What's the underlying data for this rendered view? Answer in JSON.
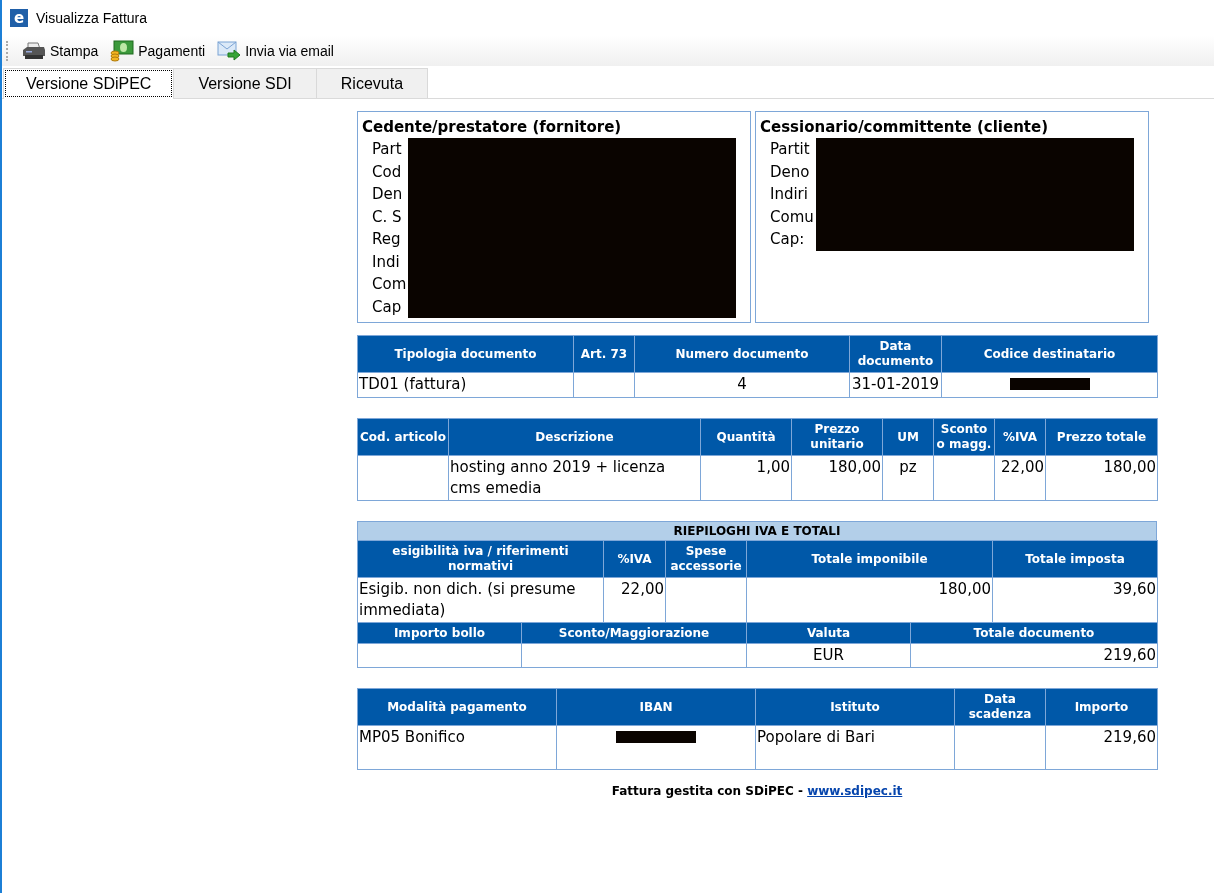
{
  "window": {
    "title": "Visualizza Fattura",
    "icon_letter": "e"
  },
  "toolbar": [
    {
      "label": "Stampa",
      "kind": "printer"
    },
    {
      "label": "Pagamenti",
      "kind": "money"
    },
    {
      "label": "Invia via email",
      "kind": "email"
    }
  ],
  "tabs": [
    {
      "label": "Versione SDiPEC",
      "selected": true
    },
    {
      "label": "Versione SDI",
      "selected": false
    },
    {
      "label": "Ricevuta",
      "selected": false
    }
  ],
  "supplier": {
    "title": "Cedente/prestatore (fornitore)",
    "lines": [
      "Part",
      "Cod",
      "Den",
      "C. S",
      "Reg",
      "Indi",
      "Com",
      "Cap"
    ]
  },
  "customer": {
    "title": "Cessionario/committente (cliente)",
    "lines": [
      "Partit",
      "Deno",
      "Indiri",
      "Comu",
      "Cap:"
    ]
  },
  "document_table": {
    "columns": [
      "Tipologia documento",
      "Art. 73",
      "Numero documento",
      "Data documento",
      "Codice destinatario"
    ],
    "rows": [
      [
        "TD01 (fattura)",
        "",
        "4",
        "31-01-2019",
        {
          "kind": "redacted"
        }
      ]
    ]
  },
  "lines_table": {
    "columns": [
      "Cod. articolo",
      "Descrizione",
      "Quantità",
      "Prezzo unitario",
      "UM",
      "Sconto o magg.",
      "%IVA",
      "Prezzo totale"
    ],
    "rows": [
      [
        "",
        "hosting anno 2019 + licenza cms emedia",
        "1,00",
        "180,00",
        "pz",
        "",
        "22,00",
        "180,00"
      ]
    ]
  },
  "summary": {
    "title": "RIEPILOGHI IVA E TOTALI",
    "vat_table": {
      "columns": [
        "esigibilità iva / riferimenti normativi",
        "%IVA",
        "Spese accessorie",
        "Totale imponibile",
        "Totale imposta"
      ],
      "rows": [
        [
          "Esigib. non dich. (si presume immediata)",
          "22,00",
          "",
          "180,00",
          "39,60"
        ]
      ]
    },
    "totals_table": {
      "columns": [
        "Importo bollo",
        "Sconto/Maggiorazione",
        "Valuta",
        "Totale documento"
      ],
      "rows": [
        [
          "",
          "",
          "EUR",
          "219,60"
        ]
      ]
    }
  },
  "payment_table": {
    "columns": [
      "Modalità pagamento",
      "IBAN",
      "Istituto",
      "Data scadenza",
      "Importo"
    ],
    "rows": [
      [
        "MP05 Bonifico",
        {
          "kind": "redacted"
        },
        "Popolare di Bari",
        "",
        "219,60"
      ]
    ]
  },
  "footer": {
    "text": "Fattura gestita con SDiPEC - ",
    "link": "www.sdipec.it"
  }
}
